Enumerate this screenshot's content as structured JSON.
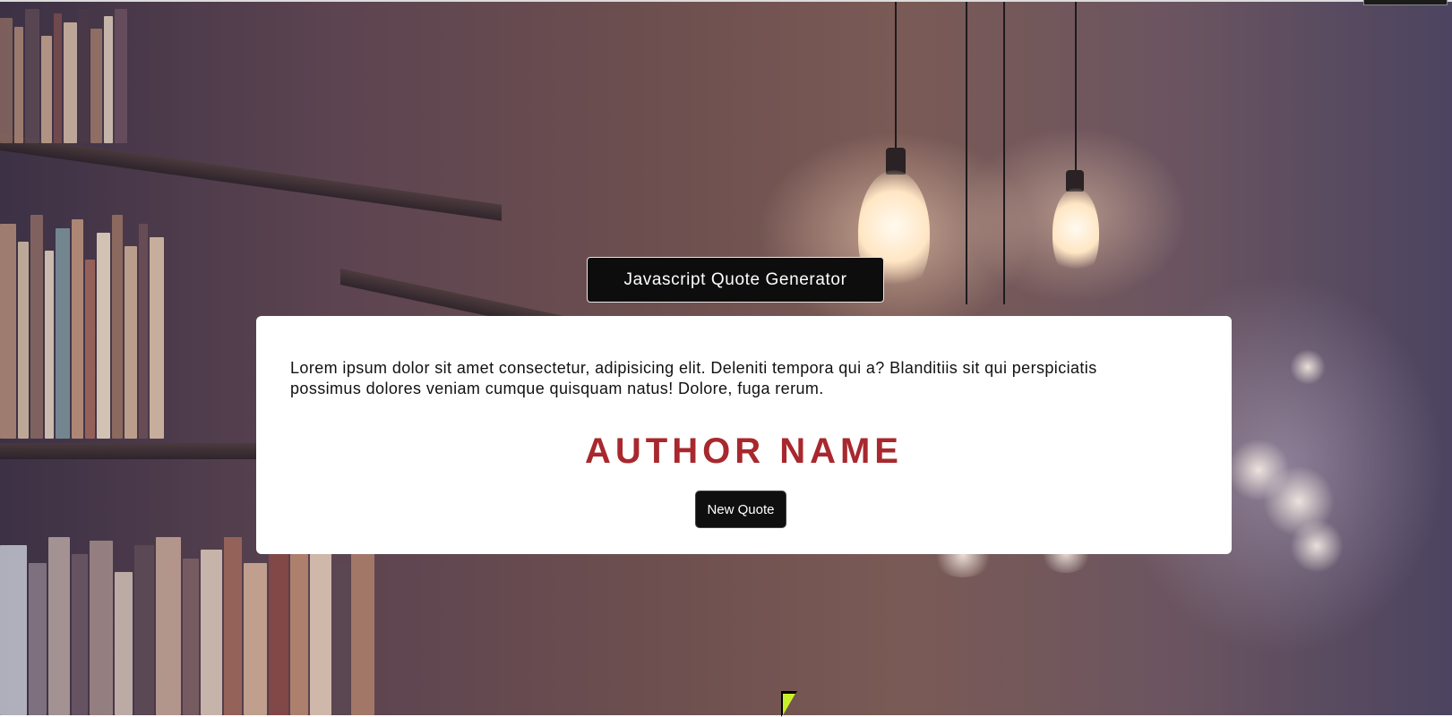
{
  "app": {
    "title": "Javascript Quote Generator"
  },
  "quote": {
    "text": "Lorem ipsum dolor sit amet consectetur, adipisicing elit. Deleniti tempora qui a? Blanditiis sit qui perspiciatis possimus dolores veniam cumque quisquam natus! Dolore, fuga rerum.",
    "author": "AUTHOR NAME"
  },
  "actions": {
    "new_quote_label": "New Quote"
  },
  "colors": {
    "author_text": "#a8282e",
    "button_bg": "#0f0f0f",
    "card_bg": "#ffffff"
  },
  "icons": {
    "cursor": "mouse-pointer-icon"
  }
}
